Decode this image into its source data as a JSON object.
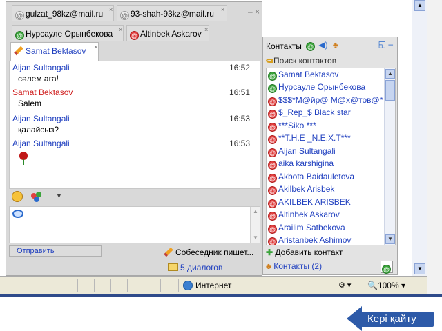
{
  "chat": {
    "tabs_row1": [
      {
        "label": "gulzat_98kz@mail.ru",
        "close": "×"
      },
      {
        "label": "93-shah-93kz@mail.ru",
        "close": "×"
      }
    ],
    "tabs_row2": [
      {
        "label": "Нурсауле Орынбекова",
        "close": "×"
      },
      {
        "label": "Altinbek Askarov",
        "close": "×"
      }
    ],
    "active_tab": {
      "label": "Samat Bektasov",
      "close": "×"
    },
    "minimize": "–",
    "close": "×",
    "messages": [
      {
        "sender": "Aijan Sultangali",
        "time": "16:52",
        "text": "сəлем аға!",
        "color": "#1f3fbf"
      },
      {
        "sender": "Samat Bektasov",
        "time": "16:51",
        "text": "Salem",
        "color": "#d02020"
      },
      {
        "sender": "Aijan Sultangali",
        "time": "16:53",
        "text": "қалайсыз?",
        "color": "#1f3fbf"
      },
      {
        "sender": "Aijan Sultangali",
        "time": "16:53",
        "text": "",
        "color": "#1f3fbf"
      }
    ],
    "send_label": "Отправить",
    "typing_label": "Собеседник пишет...",
    "dialogs_label": "5 диалогов"
  },
  "contacts": {
    "title": "Контакты",
    "search_placeholder": "Поиск контактов",
    "items": [
      {
        "name": "Samat Bektasov",
        "status": "online"
      },
      {
        "name": "Нурсауле Орынбекова",
        "status": "online"
      },
      {
        "name": "$$$*М@йр@ М@х@тов@*",
        "status": "offline"
      },
      {
        "name": "$_Rep_$ Black star",
        "status": "offline"
      },
      {
        "name": "***Siko ***",
        "status": "offline"
      },
      {
        "name": "**T.H.E _N.E.X.T***",
        "status": "offline"
      },
      {
        "name": "Aijan Sultangali",
        "status": "offline"
      },
      {
        "name": "aika karshigina",
        "status": "offline"
      },
      {
        "name": "Akbota Baidauletova",
        "status": "offline"
      },
      {
        "name": "Akilbek Arisbek",
        "status": "offline"
      },
      {
        "name": "AKILBEK ARISBEK",
        "status": "offline"
      },
      {
        "name": "Altinbek Askarov",
        "status": "offline"
      },
      {
        "name": "Arailim Satbekova",
        "status": "offline"
      },
      {
        "name": "Aristanbek Ashimov",
        "status": "offline"
      }
    ],
    "add_label": "Добавить контакт",
    "tab_label": "Контакты",
    "tab_count": "(2)"
  },
  "browser": {
    "zone_label": "Интернет",
    "zoom_label": "100%"
  },
  "back_button": {
    "label": "Кері қайту"
  },
  "colors": {
    "online": "#3aa33a",
    "offline": "#e04040",
    "link": "#1f3fbf",
    "back": "#2d5aa8"
  }
}
